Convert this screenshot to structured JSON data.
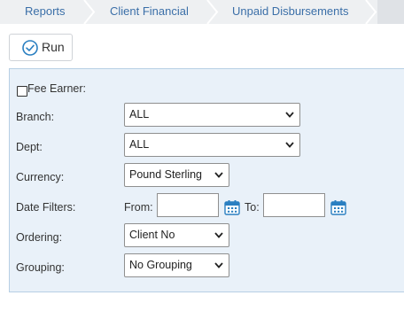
{
  "breadcrumb": {
    "items": [
      "Reports",
      "Client Financial",
      "Unpaid Disbursements"
    ]
  },
  "toolbar": {
    "run_label": "Run",
    "run_icon": "check-circle-icon"
  },
  "filters": {
    "fee_earner": {
      "label": "Fee Earner:",
      "checked": false
    },
    "branch": {
      "label": "Branch:",
      "value": "ALL"
    },
    "dept": {
      "label": "Dept:",
      "value": "ALL"
    },
    "currency": {
      "label": "Currency:",
      "value": "Pound Sterling"
    },
    "date_filters": {
      "label": "Date Filters:",
      "from_label": "From:",
      "from_value": "",
      "to_label": "To:",
      "to_value": "",
      "icon": "calendar-icon"
    },
    "ordering": {
      "label": "Ordering:",
      "value": "Client No"
    },
    "grouping": {
      "label": "Grouping:",
      "value": "No Grouping"
    }
  },
  "colors": {
    "link": "#3b6fa8",
    "accent": "#2a7fc1",
    "panel_bg": "#e9f1f9",
    "panel_border": "#b7cfe4"
  }
}
